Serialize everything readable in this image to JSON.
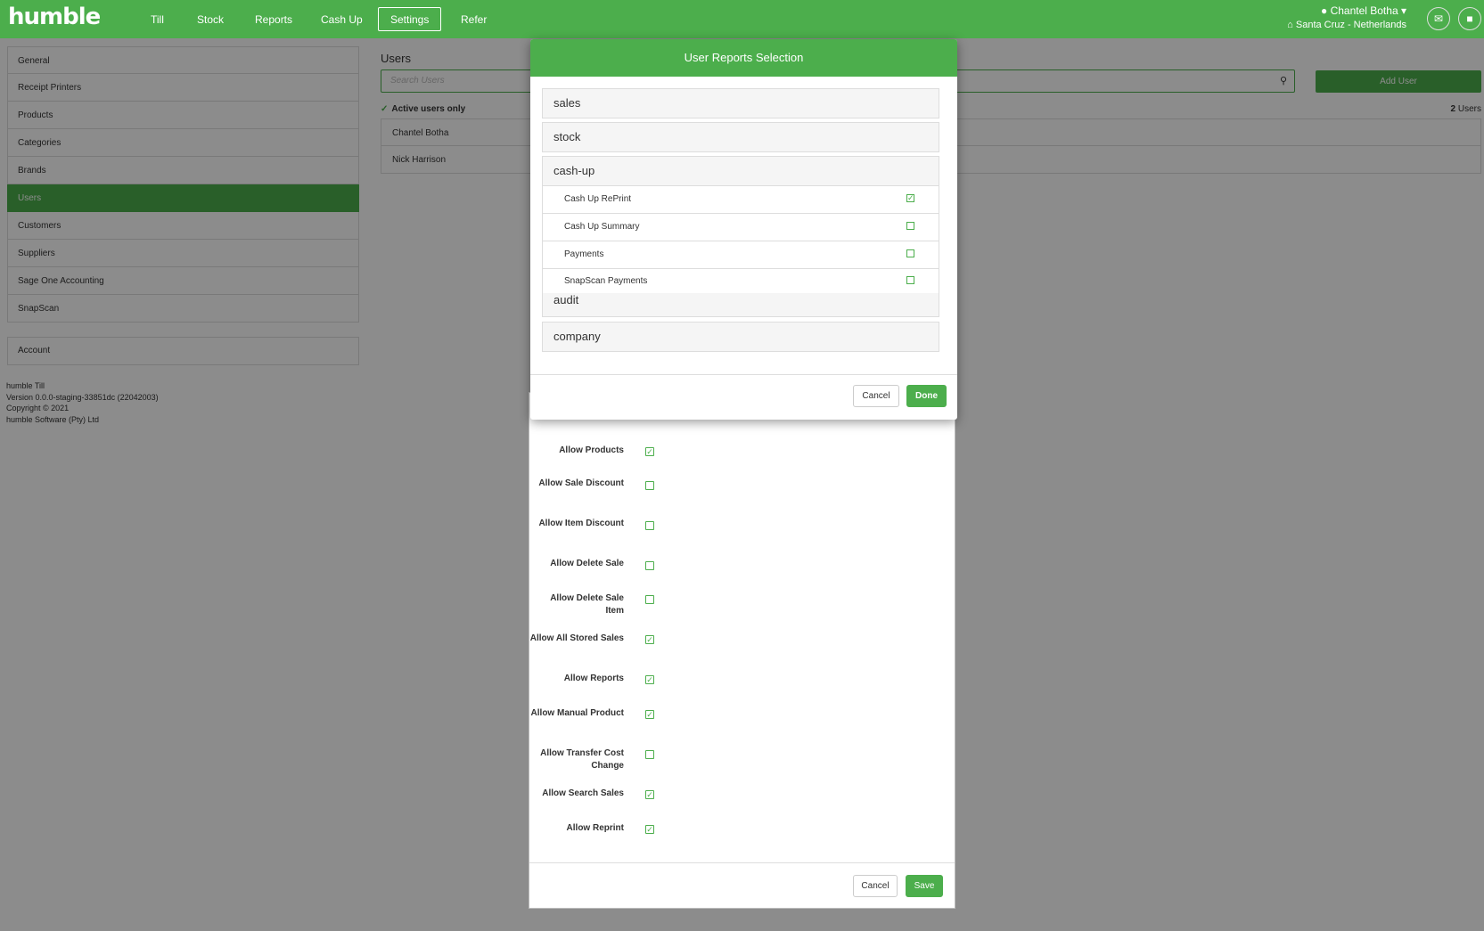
{
  "topnav": {
    "logo": "humble",
    "items": [
      "Till",
      "Stock",
      "Reports",
      "Cash Up",
      "Settings",
      "Refer"
    ],
    "active": "Settings",
    "user_name": "Chantel Botha",
    "location": "Santa Cruz - Netherlands",
    "icons": [
      "user-icon",
      "caret-down-icon",
      "home-icon",
      "chat-icon",
      "lock-icon"
    ]
  },
  "sidebar": {
    "items": [
      "General",
      "Receipt Printers",
      "Products",
      "Categories",
      "Brands",
      "Users",
      "Customers",
      "Suppliers",
      "Sage One Accounting",
      "SnapScan"
    ],
    "active": "Users",
    "account": "Account",
    "version_lines": [
      "humble Till",
      "Version 0.0.0-staging-33851dc (22042003)",
      "Copyright © 2021",
      "humble Software (Pty) Ltd"
    ]
  },
  "main": {
    "title": "Users",
    "search_placeholder": "Search Users",
    "add_user": "Add User",
    "active_only": "Active users only",
    "user_count": "2",
    "user_count_label": "Users",
    "users": [
      "Chantel Botha",
      "Nick Harrison"
    ]
  },
  "user_modal": {
    "permissions": [
      {
        "label": "Allow Products",
        "checked": true
      },
      {
        "label": "Allow Sale Discount",
        "checked": false
      },
      {
        "label": "Allow Item Discount",
        "checked": false
      },
      {
        "label": "Allow Delete Sale",
        "checked": false
      },
      {
        "label": "Allow Delete Sale Item",
        "checked": false
      },
      {
        "label": "Allow All Stored Sales",
        "checked": true
      },
      {
        "label": "Allow Reports",
        "checked": true
      },
      {
        "label": "Allow Manual Product",
        "checked": true
      },
      {
        "label": "Allow Transfer Cost Change",
        "checked": false
      },
      {
        "label": "Allow Search Sales",
        "checked": true
      },
      {
        "label": "Allow Reprint",
        "checked": true
      }
    ],
    "cancel": "Cancel",
    "save": "Save"
  },
  "reports_modal": {
    "title": "User Reports Selection",
    "groups": [
      "sales",
      "stock",
      "cash-up",
      "audit",
      "company"
    ],
    "cashup_reports": [
      {
        "label": "Cash Up RePrint",
        "checked": true
      },
      {
        "label": "Cash Up Summary",
        "checked": false
      },
      {
        "label": "Payments",
        "checked": false
      },
      {
        "label": "SnapScan Payments",
        "checked": false
      }
    ],
    "cancel": "Cancel",
    "done": "Done"
  },
  "colors": {
    "brand_green": "#4cae4c"
  }
}
